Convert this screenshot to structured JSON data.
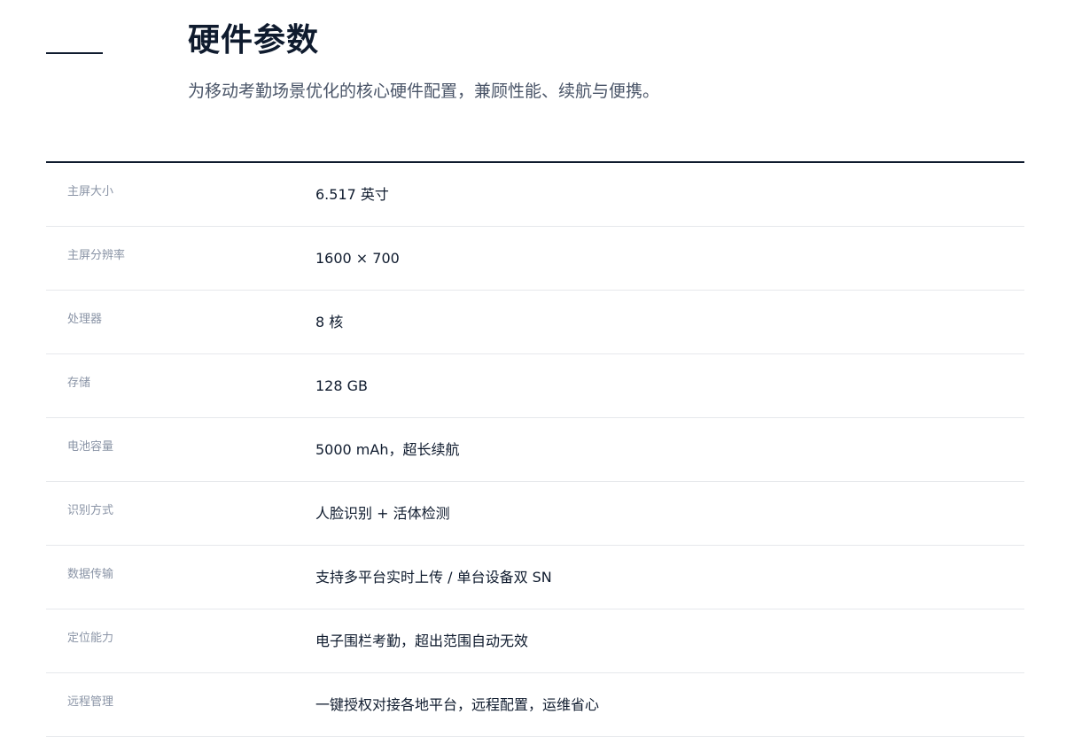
{
  "header": {
    "title": "硬件参数",
    "subtitle": "为移动考勤场景优化的核心硬件配置，兼顾性能、续航与便携。"
  },
  "specs": [
    {
      "label": "主屏大小",
      "value": "6.517 英寸"
    },
    {
      "label": "主屏分辨率",
      "value": "1600 × 700"
    },
    {
      "label": "处理器",
      "value": "8 核"
    },
    {
      "label": "存储",
      "value": "128 GB"
    },
    {
      "label": "电池容量",
      "value": "5000 mAh，超长续航"
    },
    {
      "label": "识别方式",
      "value": "人脸识别 + 活体检测"
    },
    {
      "label": "数据传输",
      "value": "支持多平台实时上传 / 单台设备双 SN"
    },
    {
      "label": "定位能力",
      "value": "电子围栏考勤，超出范围自动无效"
    },
    {
      "label": "远程管理",
      "value": "一键授权对接各地平台，远程配置，运维省心"
    }
  ]
}
